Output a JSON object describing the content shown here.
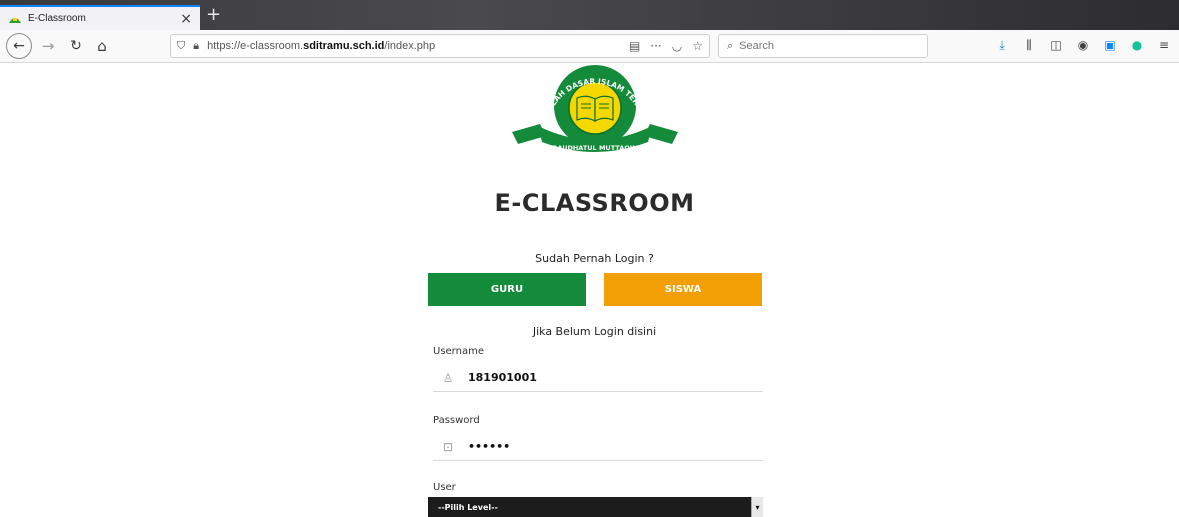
{
  "browser": {
    "tab_title": "E-Classroom",
    "tab_close": "×",
    "new_tab": "+",
    "url_prefix": "https://e-classroom.",
    "url_domain": "sditramu.sch.id",
    "url_path": "/index.php",
    "search_placeholder": "Search"
  },
  "logo": {
    "arc_text": "SEKOLAH DASAR ISLAM TERPADU",
    "ribbon_text": "RAUDHATUL MUTTAQIN"
  },
  "page": {
    "heading": "E-CLASSROOM",
    "already_login": "Sudah Pernah Login ?",
    "guru_label": "GURU",
    "siswa_label": "SISWA",
    "not_login": "Jika Belum Login disini",
    "username_label": "Username",
    "username_value": "181901001",
    "password_label": "Password",
    "password_value": "••••••",
    "user_label": "User",
    "level_selected": "--Pilih Level--"
  },
  "colors": {
    "guru": "#138b3a",
    "siswa": "#f29f05",
    "accent": "#0a84ff"
  }
}
